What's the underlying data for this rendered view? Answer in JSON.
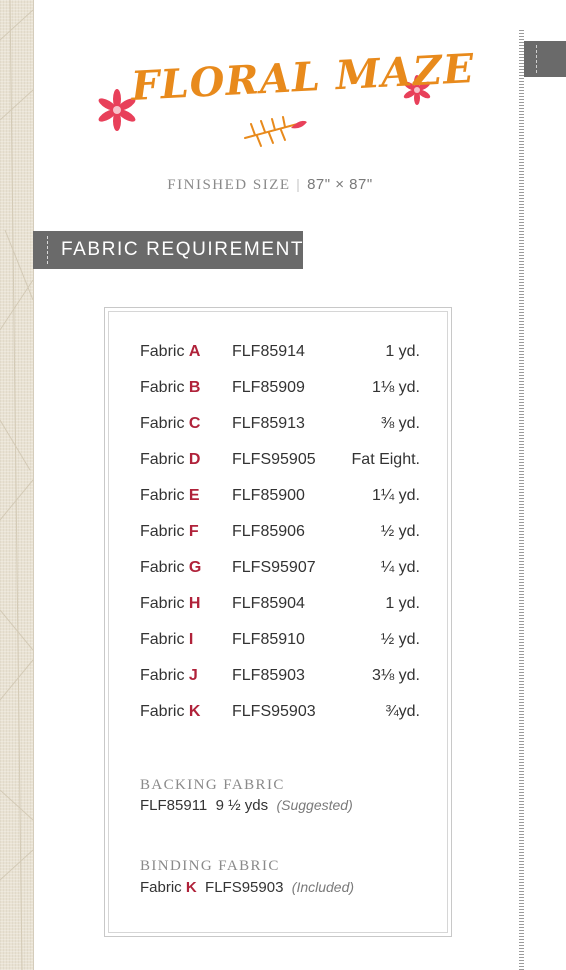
{
  "logo": {
    "title": "FLORAL MAZE"
  },
  "finished": {
    "label": "FINISHED SIZE",
    "separator": "|",
    "size": "87\" × 87\""
  },
  "banner": {
    "title": "FABRIC REQUIREMENTS"
  },
  "fabrics": [
    {
      "prefix": "Fabric",
      "letter": "A",
      "code": "FLF85914",
      "qty": "1 yd."
    },
    {
      "prefix": "Fabric",
      "letter": "B",
      "code": "FLF85909",
      "qty": "1⅛ yd."
    },
    {
      "prefix": "Fabric",
      "letter": "C",
      "code": "FLF85913",
      "qty": "⅜ yd."
    },
    {
      "prefix": "Fabric",
      "letter": "D",
      "code": "FLFS95905",
      "qty": "Fat Eight."
    },
    {
      "prefix": "Fabric",
      "letter": "E",
      "code": "FLF85900",
      "qty": "1¼ yd."
    },
    {
      "prefix": "Fabric",
      "letter": "F",
      "code": "FLF85906",
      "qty": "½ yd."
    },
    {
      "prefix": "Fabric",
      "letter": "G",
      "code": "FLFS95907",
      "qty": "¼ yd."
    },
    {
      "prefix": "Fabric",
      "letter": "H",
      "code": "FLF85904",
      "qty": "1 yd."
    },
    {
      "prefix": "Fabric",
      "letter": "I",
      "code": "FLF85910",
      "qty": "½ yd."
    },
    {
      "prefix": "Fabric",
      "letter": "J",
      "code": "FLF85903",
      "qty": "3⅛ yd."
    },
    {
      "prefix": "Fabric",
      "letter": "K",
      "code": "FLFS95903",
      "qty": "¾yd."
    }
  ],
  "backing": {
    "heading": "BACKING FABRIC",
    "code": "FLF85911",
    "qty": "9 ½ yds",
    "note": "(Suggested)"
  },
  "binding": {
    "heading": "BINDING FABRIC",
    "prefix": "Fabric",
    "letter": "K",
    "code": "FLFS95903",
    "note": "(Included)"
  },
  "colors": {
    "accent_orange": "#e88a1c",
    "accent_red": "#b0223a",
    "flower_pink": "#e8405a",
    "banner_gray": "#6a6a6a"
  }
}
